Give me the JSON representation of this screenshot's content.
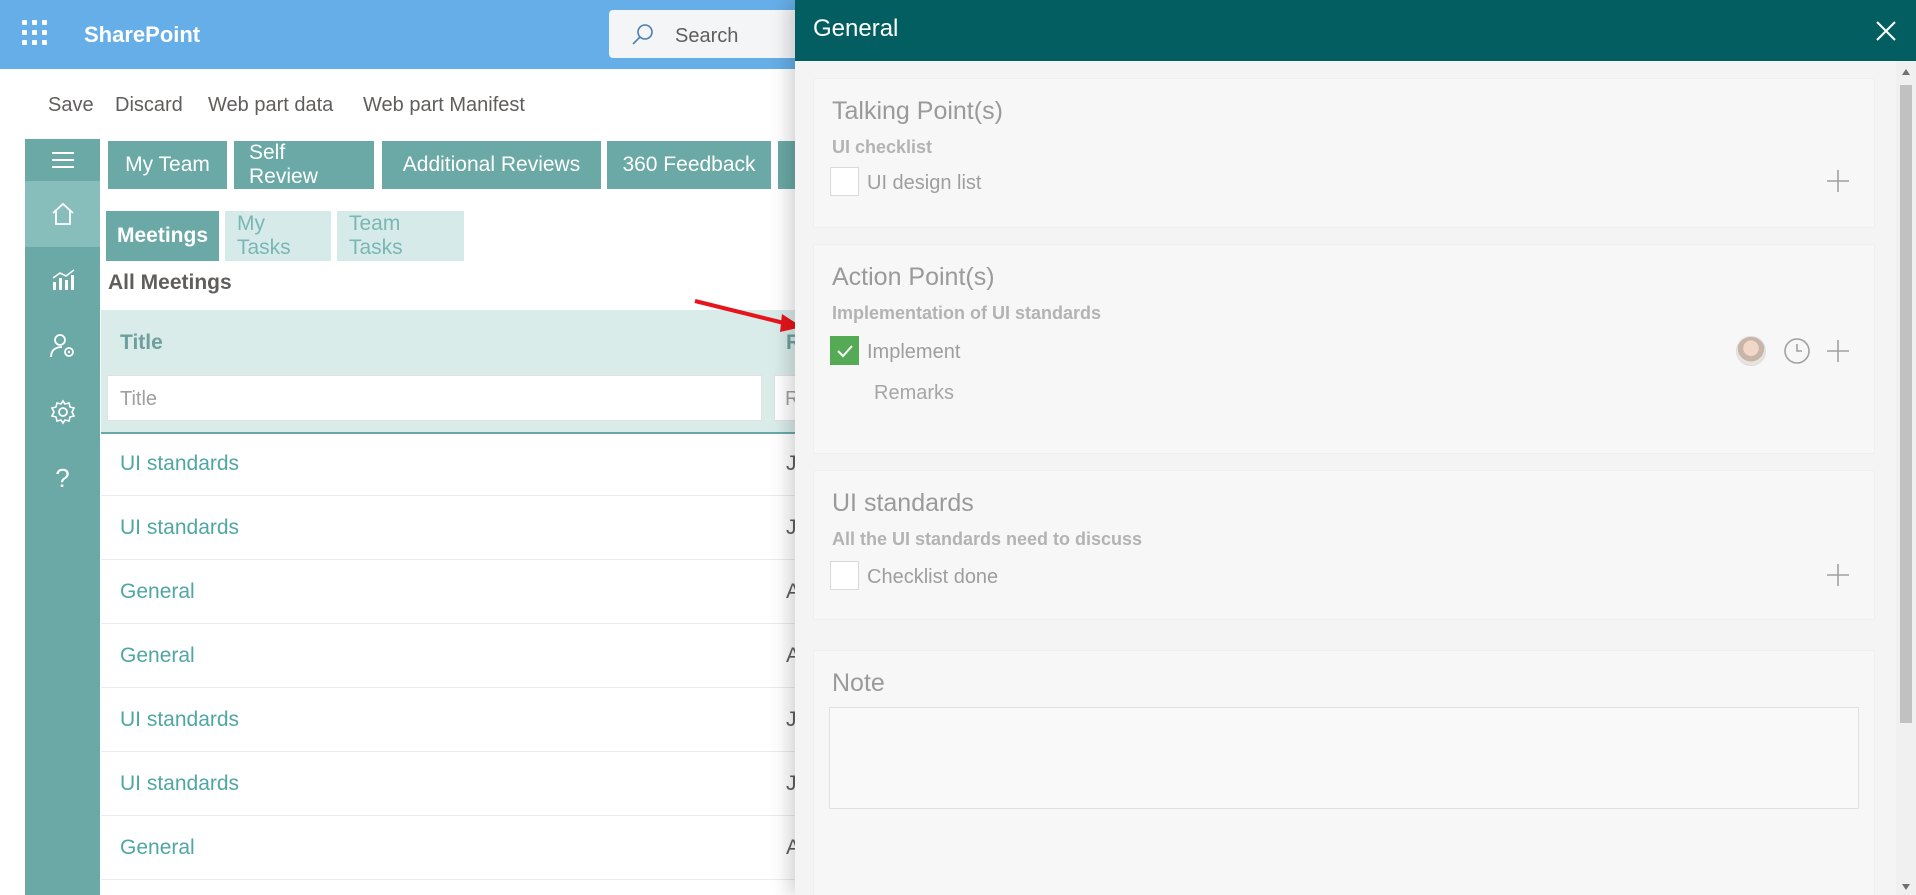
{
  "suite": {
    "brand": "SharePoint",
    "search_placeholder": "Search",
    "icons": [
      "waffle-icon",
      "search-icon"
    ]
  },
  "commandbar": {
    "save": "Save",
    "discard": "Discard",
    "webpart_data": "Web part data",
    "webpart_manifest": "Web part Manifest"
  },
  "rail": {
    "items": [
      "menu-icon",
      "home-icon",
      "chart-icon",
      "user-settings-icon",
      "gear-icon",
      "help-icon"
    ],
    "help_glyph": "?"
  },
  "tabs": {
    "main": [
      "My Team",
      "Self Review",
      "Additional Reviews",
      "360 Feedback"
    ],
    "sub": [
      "Meetings",
      "My Tasks",
      "Team Tasks"
    ],
    "active_sub": "Meetings"
  },
  "list": {
    "heading": "All Meetings",
    "columns": [
      "Title",
      "R"
    ],
    "filter_placeholders": [
      "Title",
      "R"
    ],
    "rows": [
      {
        "title": "UI standards",
        "col2": "Ju"
      },
      {
        "title": "UI standards",
        "col2": "Ju"
      },
      {
        "title": "General",
        "col2": "A"
      },
      {
        "title": "General",
        "col2": "A"
      },
      {
        "title": "UI standards",
        "col2": "Ju"
      },
      {
        "title": "UI standards",
        "col2": "Ju"
      },
      {
        "title": "General",
        "col2": "A"
      }
    ]
  },
  "panel": {
    "title": "General",
    "sections": [
      {
        "title": "Talking Point(s)",
        "subtitle": "UI checklist",
        "items": [
          {
            "label": "UI design list",
            "checked": false
          }
        ]
      },
      {
        "title": "Action Point(s)",
        "subtitle": "Implementation of UI standards",
        "items": [
          {
            "label": "Implement",
            "checked": true
          }
        ],
        "remarks": "Remarks"
      },
      {
        "title": "UI standards",
        "subtitle": "All the UI standards need to discuss",
        "items": [
          {
            "label": "Checklist done",
            "checked": false
          }
        ]
      }
    ],
    "note": {
      "title": "Note",
      "value": ""
    }
  },
  "colors": {
    "suitebar": "#65aee7",
    "panel_header": "#025e60",
    "teal": "#6aa9a6",
    "check_green": "#55aa55",
    "arrow": "#e8141b"
  }
}
